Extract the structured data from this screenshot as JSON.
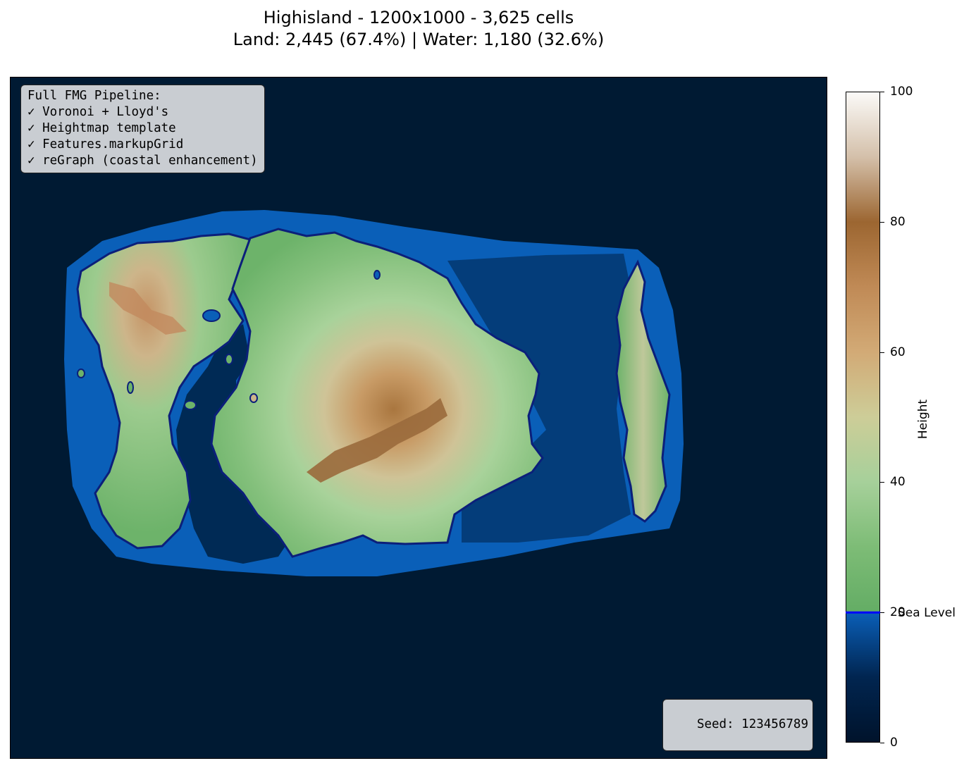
{
  "title": {
    "line1": "Highisland - 1200x1000 - 3,625 cells",
    "line2": "Land: 2,445 (67.4%) | Water: 1,180 (32.6%)"
  },
  "map": {
    "name": "Highisland",
    "width_units": 1200,
    "height_units": 1000,
    "cells": 3625,
    "land_cells": 2445,
    "land_percent": 67.4,
    "water_cells": 1180,
    "water_percent": 32.6,
    "colors": {
      "deep_water": "#001a33",
      "shallow_water": "#0a5fb8",
      "coastline": "#0b1f7a",
      "lowland": "#6db36a",
      "midland": "#a6cf92",
      "highland": "#c9a06a",
      "peak": "#9a6a3c"
    }
  },
  "info_box": {
    "heading": "Full FMG Pipeline:",
    "steps": [
      "✓ Voronoi + Lloyd's",
      "✓ Heightmap template",
      "✓ Features.markupGrid",
      "✓ reGraph (coastal enhancement)"
    ]
  },
  "seed_label": "Seed: 123456789",
  "colorbar": {
    "label": "Height",
    "min": 0,
    "max": 100,
    "ticks": [
      "0",
      "20",
      "40",
      "60",
      "80",
      "100"
    ],
    "sea_level": 20,
    "sea_level_label": "Sea Level",
    "sea_level_color": "#0000ff"
  }
}
